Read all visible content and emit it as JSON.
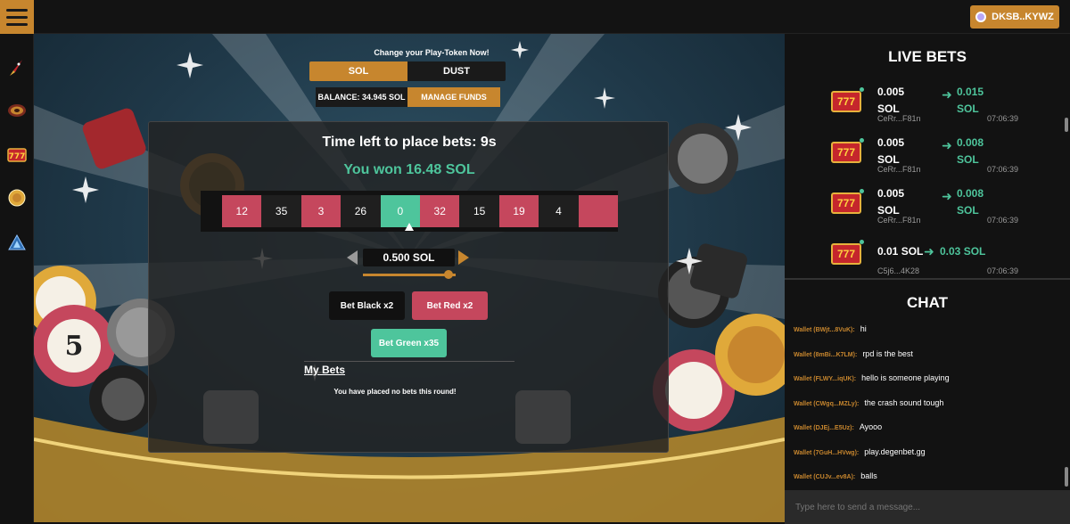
{
  "header": {
    "menu_icon": "hamburger-icon",
    "wallet_label": "DKSB..KYWZ",
    "wallet_icon": "wallet-icon"
  },
  "sidebar": {
    "items": [
      {
        "icon": "rocket-icon",
        "label": "crash"
      },
      {
        "icon": "roulette-icon",
        "label": "roulette"
      },
      {
        "icon": "slots-icon",
        "label": "slots"
      },
      {
        "icon": "coin-icon",
        "label": "coinflip"
      },
      {
        "icon": "triangle-icon",
        "label": "plinko"
      }
    ]
  },
  "game": {
    "token_title": "Change your Play-Token Now!",
    "tokens": {
      "sol": "SOL",
      "dust": "DUST"
    },
    "balance": "BALANCE: 34.945 SOL",
    "manage_funds": "MANAGE FUNDS",
    "timer": "Time left to place bets: 9s",
    "result": "You won 16.48 SOL",
    "strip": [
      {
        "n": "12",
        "c": "red"
      },
      {
        "n": "35",
        "c": "black"
      },
      {
        "n": "3",
        "c": "red"
      },
      {
        "n": "26",
        "c": "black"
      },
      {
        "n": "0",
        "c": "green"
      },
      {
        "n": "32",
        "c": "red"
      },
      {
        "n": "15",
        "c": "black"
      },
      {
        "n": "19",
        "c": "red"
      },
      {
        "n": "4",
        "c": "black"
      },
      {
        "n": "",
        "c": "red"
      }
    ],
    "amount": "0.500 SOL",
    "slider_level": 0.92,
    "bet_black": "Bet Black x2",
    "bet_red": "Bet Red x2",
    "bet_green": "Bet Green x35",
    "my_bets_title": "My Bets",
    "no_bets": "You have placed no bets this round!"
  },
  "live_bets": {
    "title": "LIVE BETS",
    "rows": [
      {
        "amount": "0.005 SOL",
        "win": "0.015 SOL",
        "user": "CeRr...F81n",
        "time": "07:06:39"
      },
      {
        "amount": "0.005 SOL",
        "win": "0.008 SOL",
        "user": "CeRr...F81n",
        "time": "07:06:39"
      },
      {
        "amount": "0.005 SOL",
        "win": "0.008 SOL",
        "user": "CeRr...F81n",
        "time": "07:06:39"
      },
      {
        "amount": "0.01 SOL",
        "win": "0.03 SOL",
        "user": "C5j6...4K28",
        "time": "07:06:39"
      }
    ]
  },
  "chat": {
    "title": "CHAT",
    "messages": [
      {
        "wallet": "Wallet (BWjt...8VuK):",
        "text": "hi"
      },
      {
        "wallet": "Wallet (8mBi...K7LM):",
        "text": "rpd is the best"
      },
      {
        "wallet": "Wallet (FLWY...iqUK):",
        "text": "hello is someone playing"
      },
      {
        "wallet": "Wallet (CWgq...MZLy):",
        "text": "the crash sound tough"
      },
      {
        "wallet": "Wallet (DJEj...E5Uz):",
        "text": "Ayooo"
      },
      {
        "wallet": "Wallet (7GuH...HVwg):",
        "text": "play.degenbet.gg"
      },
      {
        "wallet": "Wallet (CUJv...ev8A):",
        "text": "balls"
      }
    ],
    "placeholder": "Type here to send a message..."
  },
  "colors": {
    "accent": "#c7862e",
    "red": "#c5475d",
    "green": "#4ec59c",
    "black": "#1f1f1f"
  }
}
